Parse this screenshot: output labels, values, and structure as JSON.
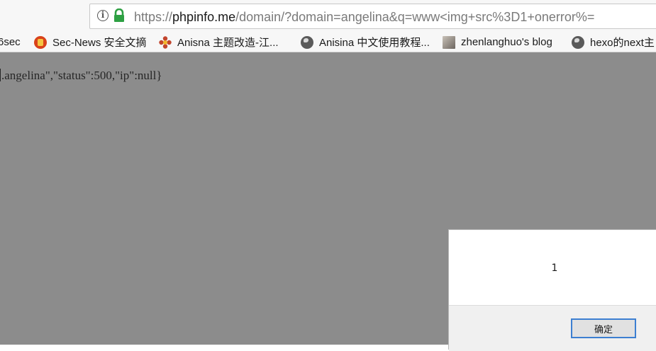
{
  "addressbar": {
    "url_scheme": "https://",
    "url_host": "phpinfo.me",
    "url_rest": "/domain/?domain=angelina&q=www<img+src%3D1+onerror%="
  },
  "bookmarks": [
    {
      "label": "6sec",
      "icon": "none"
    },
    {
      "label": "Sec-News 安全文摘",
      "icon": "sec-news-icon"
    },
    {
      "label": "Anisna 主题改造-江...",
      "icon": "flower-icon"
    },
    {
      "label": "Anisina 中文使用教程...",
      "icon": "globe-icon"
    },
    {
      "label": "zhenlanghuo's blog",
      "icon": "avatar-icon"
    },
    {
      "label": "hexo的next主",
      "icon": "globe-icon"
    }
  ],
  "page": {
    "json_text": ".angelina\",\"status\":500,\"ip\":null}"
  },
  "dialog": {
    "message": "1",
    "ok_label": "确定"
  },
  "colors": {
    "overlay": "#8c8c8c",
    "lock_green": "#2ea043",
    "ok_border": "#3c7fd1"
  }
}
